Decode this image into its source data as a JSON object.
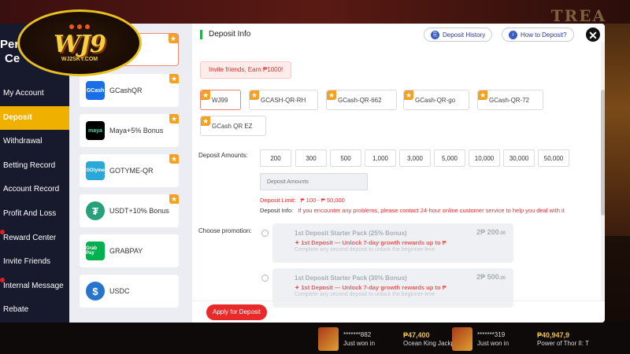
{
  "background": {
    "brand_text": "TREA",
    "jackpots": [
      {
        "user": "*******882",
        "action": "Just won in",
        "amount": "₱47,400",
        "game": "Ocean King Jackpot"
      },
      {
        "user": "*******319",
        "action": "Just won in",
        "amount": "₱40,947,9",
        "game": "Power of Thor II: T"
      }
    ]
  },
  "logo": {
    "main": "WJ9",
    "sub": "WJ2SKY.COM"
  },
  "sidebar": {
    "header": [
      "Per",
      "Ce"
    ],
    "items": [
      {
        "label": "My Account",
        "active": false,
        "dot": false
      },
      {
        "label": "Deposit",
        "active": true,
        "dot": false
      },
      {
        "label": "Withdrawal",
        "active": false,
        "dot": false
      },
      {
        "label": "Betting Record",
        "active": false,
        "dot": false
      },
      {
        "label": "Account Record",
        "active": false,
        "dot": false
      },
      {
        "label": "Profit And Loss",
        "active": false,
        "dot": false
      },
      {
        "label": "Reward Center",
        "active": false,
        "dot": true
      },
      {
        "label": "Invite Friends",
        "active": false,
        "dot": false
      },
      {
        "label": "Internal Message",
        "active": false,
        "dot": true
      },
      {
        "label": "Rebate",
        "active": false,
        "dot": false
      }
    ]
  },
  "methods": [
    {
      "label": "",
      "icon": "",
      "color": "#ffffff"
    },
    {
      "label": "GCashQR",
      "icon": "GCash",
      "color": "#1a6fe8"
    },
    {
      "label": "Maya+5% Bonus",
      "icon": "maya",
      "color": "#000000"
    },
    {
      "label": "GOTYME-QR",
      "icon": "GOtyme",
      "color": "#2aa8d8"
    },
    {
      "label": "USDT+10% Bonus",
      "icon": "₮",
      "color": "#26a17b"
    },
    {
      "label": "GRABPAY",
      "icon": "Grab Pay",
      "color": "#00b14f"
    },
    {
      "label": "USDC",
      "icon": "$",
      "color": "#2775ca"
    }
  ],
  "panel": {
    "title": "Deposit Info",
    "history_label": "Deposit History",
    "howto_label": "How to Deposit?",
    "close_glyph": "✕",
    "invite_text": "Invite friends, Earn ₱1000!",
    "channels": [
      "WJ99",
      "GCASH-QR-RH",
      "GCash-QR-662",
      "GCash-QR-go",
      "GCash-QR-72",
      "GCash QR EZ"
    ],
    "amounts_label": "Deposit Amounts:",
    "amounts": [
      "200",
      "300",
      "500",
      "1,000",
      "3,000",
      "5,000",
      "10,000",
      "30,000",
      "50,000"
    ],
    "amount_placeholder": "Deposit Amounts",
    "limit_label": "Deposit Limit:",
    "limit_value": "₱ 100 - ₱ 50,000",
    "info_label": "Deposit Info:",
    "info_value": "If you encounter any problems, please contact 24-hour online customer service to help you deal with it",
    "promotion_label": "Choose promotion:",
    "promotions": [
      {
        "title": "1st Deposit Starter Pack (25% Bonus)",
        "tag": "1st Deposit — Unlock 7-day growth rewards up to ₱",
        "desc": "Complete any second deposit to unlock the beginner-leve",
        "amount": "2₱ 200",
        "cents": ".00"
      },
      {
        "title": "1st Deposit Starter Pack (30% Bonus)",
        "tag": "1st Deposit — Unlock 7-day growth rewards up to ₱",
        "desc": "Complete any second deposit to unlock the beginner-leve",
        "amount": "2₱ 500",
        "cents": ".00"
      }
    ],
    "apply_label": "Apply for Deposit"
  },
  "colors": {
    "accent": "#f0b000",
    "danger": "#e82a2a",
    "brand": "#22b04a"
  }
}
